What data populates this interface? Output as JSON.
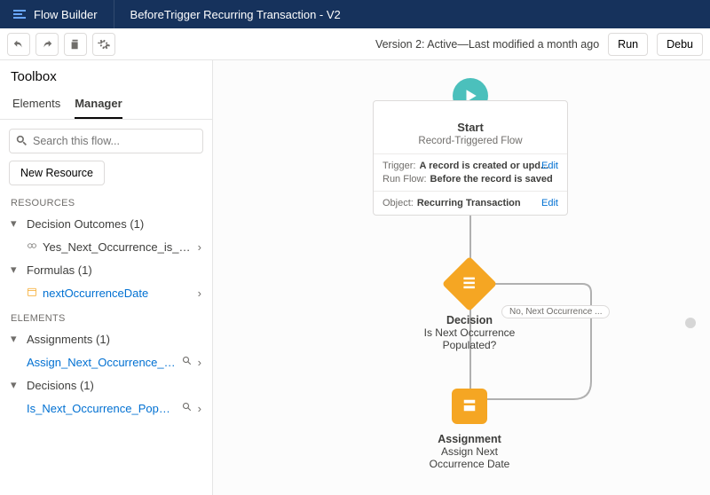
{
  "topbar": {
    "app": "Flow Builder",
    "flowName": "BeforeTrigger Recurring Transaction - V2"
  },
  "actionbar": {
    "versionText": "Version 2: Active—Last modified a month ago",
    "run": "Run",
    "debug": "Debu"
  },
  "sidebar": {
    "title": "Toolbox",
    "tabs": {
      "elements": "Elements",
      "manager": "Manager"
    },
    "searchPlaceholder": "Search this flow...",
    "newResource": "New Resource",
    "sections": {
      "resources": "RESOURCES",
      "elements": "ELEMENTS"
    },
    "resources": {
      "decisionOutcomes": {
        "label": "Decision Outcomes (1)",
        "items": [
          "Yes_Next_Occurrence_is_populated"
        ]
      },
      "formulas": {
        "label": "Formulas (1)",
        "items": [
          "nextOccurrenceDate"
        ]
      }
    },
    "elements": {
      "assignments": {
        "label": "Assignments (1)",
        "items": [
          "Assign_Next_Occurrence_Date"
        ]
      },
      "decisions": {
        "label": "Decisions (1)",
        "items": [
          "Is_Next_Occurrence_Populated"
        ]
      }
    }
  },
  "canvas": {
    "start": {
      "title": "Start",
      "subtitle": "Record-Triggered Flow",
      "triggerLabel": "Trigger:",
      "triggerValue": "A record is created or upd...",
      "runFlowLabel": "Run Flow:",
      "runFlowValue": "Before the record is saved",
      "objectLabel": "Object:",
      "objectValue": "Recurring Transaction",
      "edit": "Edit"
    },
    "decision": {
      "type": "Decision",
      "name": "Is Next Occurrence Populated?",
      "outcomeNo": "No, Next Occurrence ..."
    },
    "assignment": {
      "type": "Assignment",
      "name": "Assign Next Occurrence Date"
    }
  }
}
